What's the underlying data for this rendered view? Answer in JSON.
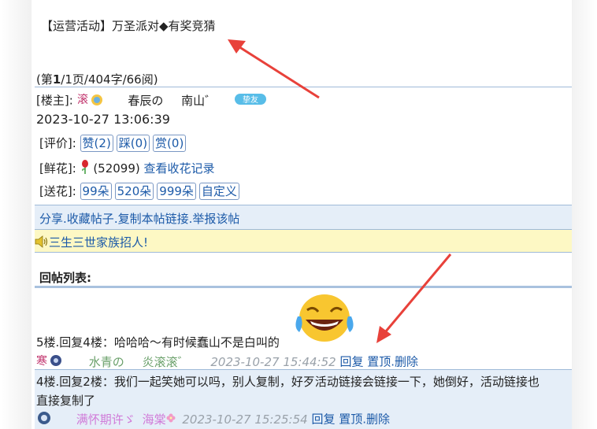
{
  "post": {
    "title": "【运营活动】万圣派对◆有奖竞猜",
    "page_info_prefix": "(第",
    "page_info_bold": "1",
    "page_info_suffix": "/1页/404字/66阅)",
    "owner_label": "[楼主]:",
    "owner_name": "春辰の",
    "owner_name2": "南山゛",
    "owner_badge": "挚友",
    "datetime": "2023-10-27 13:06:39",
    "rating_label": "[评价]:",
    "like_btn": "赞(2)",
    "dislike_btn": "踩(0)",
    "reward_btn": "赏(0)",
    "flowers_label": "[鲜花]:",
    "flowers_count": "(52099)",
    "flowers_link": "查看收花记录",
    "send_label": "[送花]:",
    "send_options": [
      "99朵",
      "520朵",
      "999朵",
      "自定义"
    ]
  },
  "actions": {
    "share": "分享",
    "favorite": "收藏帖子",
    "copy_link": "复制本帖链接",
    "report": "举报该帖",
    "separator": "."
  },
  "notice": {
    "text": "三生三世家族招人!"
  },
  "replies_header": "回帖列表:",
  "replies": [
    {
      "text": "5楼.回复4楼：哈哈哈～有时候蠢山不是白叫的",
      "emoji": "😂",
      "user1": "水青の",
      "user2": "炎滚滚゛",
      "datetime": "2023-10-27 15:44:52",
      "reply": "回复",
      "pin_delete": "置顶.删除"
    },
    {
      "text_line1": "4楼.回复2楼：我们一起笑她可以吗，别人复制，好歹活动链接会链接一下，她倒好，活动链接也",
      "text_line2": "直接复制了",
      "user1": "满怀期许ゞ",
      "user2": "海棠",
      "datetime": "2023-10-27 15:25:54",
      "reply": "回复",
      "pin_delete": "置顶.删除"
    }
  ],
  "colors": {
    "link": "#1c5aa8",
    "band_blue": "#e5eef8",
    "band_yellow": "#fdf8c4",
    "arrow": "#e8413a"
  },
  "icons": [
    "user-avatar-icon",
    "vip-badge-icon",
    "rose-icon",
    "speaker-icon",
    "laughing-emoji",
    "red-arrow"
  ]
}
